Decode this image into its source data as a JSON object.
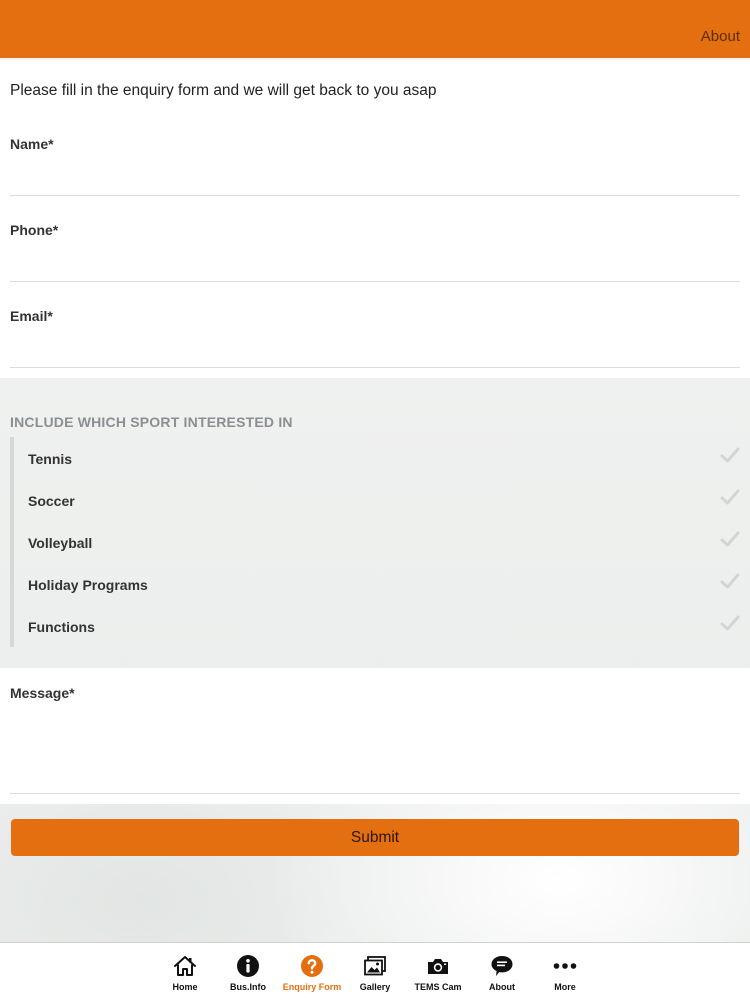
{
  "header": {
    "link_label": "About"
  },
  "form": {
    "intro": "Please fill in the enquiry form and we will get back to you asap",
    "fields": [
      {
        "label": "Name*",
        "value": ""
      },
      {
        "label": "Phone*",
        "value": ""
      },
      {
        "label": "Email*",
        "value": ""
      }
    ],
    "sports_heading": "INCLUDE WHICH SPORT INTERESTED IN",
    "sports": [
      {
        "label": "Tennis",
        "checked": false
      },
      {
        "label": "Soccer",
        "checked": false
      },
      {
        "label": "Volleyball",
        "checked": false
      },
      {
        "label": "Holiday Programs",
        "checked": false
      },
      {
        "label": "Functions",
        "checked": false
      }
    ],
    "message": {
      "label": "Message*",
      "value": ""
    },
    "submit_label": "Submit"
  },
  "tabbar": {
    "active": "Enquiry Form",
    "items": [
      {
        "label": "Home",
        "icon": "home-icon"
      },
      {
        "label": "Bus.Info",
        "icon": "info-icon"
      },
      {
        "label": "Enquiry Form",
        "icon": "question-icon"
      },
      {
        "label": "Gallery",
        "icon": "gallery-icon"
      },
      {
        "label": "TEMS Cam",
        "icon": "camera-icon"
      },
      {
        "label": "About",
        "icon": "speech-bubble-icon"
      },
      {
        "label": "More",
        "icon": "more-icon"
      }
    ]
  },
  "colors": {
    "accent": "#e46f10",
    "tab_active": "#e46f10",
    "check_unchecked": "#d4d4d4"
  }
}
